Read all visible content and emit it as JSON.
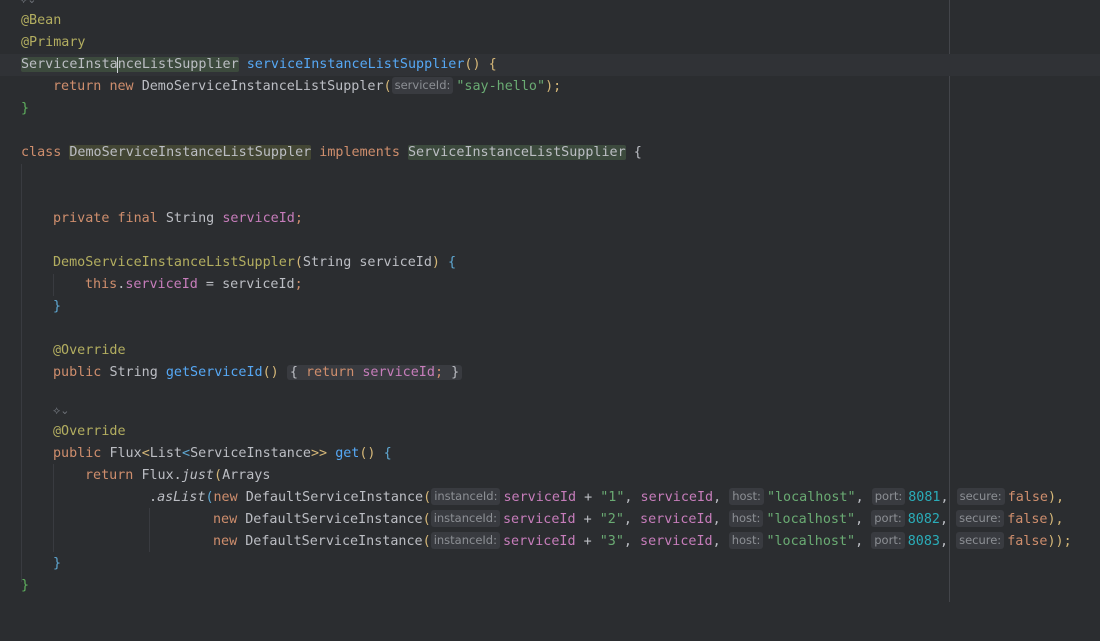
{
  "colors": {
    "background": "#2b2d30",
    "keyword": "#cf8e6d",
    "annotation": "#b3ae60",
    "method": "#56a8f5",
    "string": "#6aab73",
    "field": "#c77dbb",
    "number": "#2aacb8",
    "text": "#bcbec4"
  },
  "icons": {
    "gutter_top": "generic-method-icon",
    "gutter_get": "generic-method-icon",
    "chevron": "chevron-down-icon"
  },
  "code": {
    "ann_bean": "@Bean",
    "ann_primary": "@Primary",
    "type_supplier": "ServiceInstanceListSupplier",
    "method_supplier": "serviceInstanceListSupplier",
    "paren_empty": "()",
    "open_brace": "{",
    "close_brace": "}",
    "kw_return": "return",
    "kw_new": "new",
    "type_demo": "DemoServiceInstanceListSuppler",
    "paren_open": "(",
    "hint_serviceId": "serviceId:",
    "str_say_hello": "\"say-hello\"",
    "paren_close_semi": ");",
    "kw_class": "class",
    "kw_implements": "implements",
    "kw_private": "private",
    "kw_final": "final",
    "type_string": "String",
    "field_serviceId": "serviceId",
    "semi": ";",
    "param_serviceId": "serviceId",
    "kw_this": "this",
    "dot": ".",
    "assign": " = ",
    "ann_override": "@Override",
    "kw_public": "public",
    "method_getServiceId": "getServiceId",
    "type_flux": "Flux",
    "lt": "<",
    "type_list": "List",
    "type_service_instance": "ServiceInstance",
    "gtgt": ">>",
    "method_get": "get",
    "flux_dot": "Flux.",
    "method_just": "just",
    "arrays": "Arrays",
    "method_asList": "asList",
    "type_default": "DefaultServiceInstance",
    "hint_instanceId": "instanceId:",
    "hint_host": "host:",
    "hint_port": "port:",
    "hint_secure": "secure:",
    "plus": " + ",
    "str_1": "\"1\"",
    "str_2": "\"2\"",
    "str_3": "\"3\"",
    "comma": ", ",
    "str_localhost": "\"localhost\"",
    "port_1": "8081",
    "port_2": "8082",
    "port_3": "8083",
    "kw_false": "false",
    "close_1": "),",
    "close_3": "));"
  }
}
